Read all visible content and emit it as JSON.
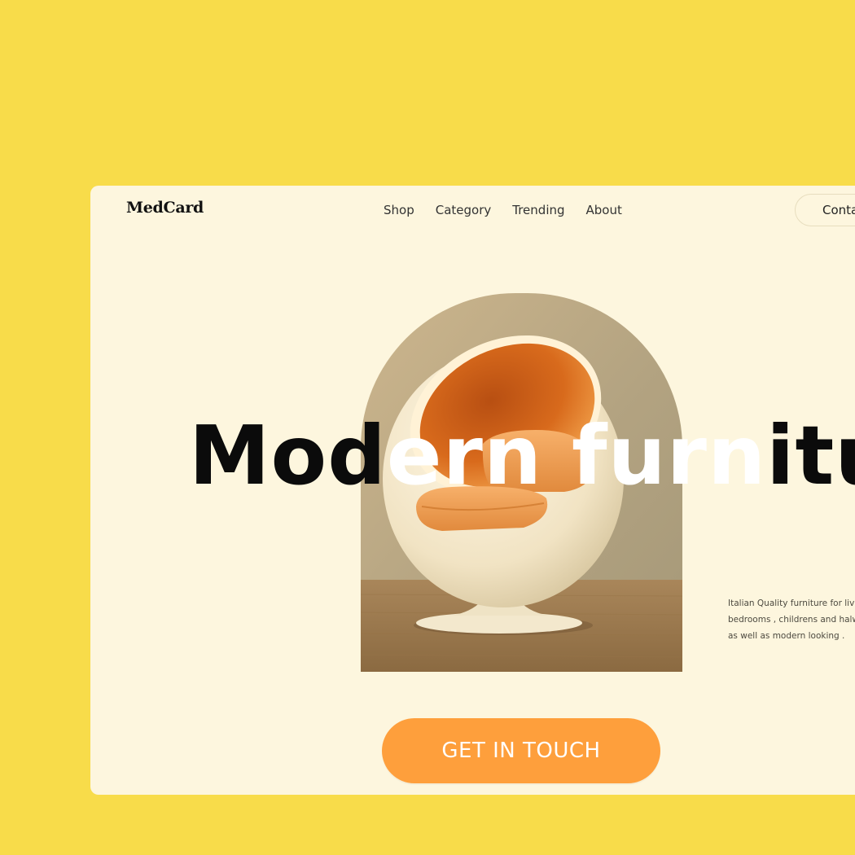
{
  "brand": {
    "name": "MedCard"
  },
  "nav": {
    "items": [
      {
        "label": "Shop"
      },
      {
        "label": "Category"
      },
      {
        "label": "Trending"
      },
      {
        "label": "About"
      }
    ],
    "contact_label": "Conta"
  },
  "hero": {
    "headline_segments": [
      "Mod",
      "ern fur",
      "n",
      "iture"
    ],
    "image_icon": "egg-chair-image",
    "description_lines": [
      "Italian Quality furniture for livir",
      "bedrooms , childrens and halwa",
      "as well as modern looking ."
    ],
    "cta_label": "GET IN TOUCH"
  },
  "colors": {
    "background": "#F8DC4A",
    "card": "#FDF6DE",
    "accent": "#FE9F3C",
    "text": "#0B0B0B"
  }
}
